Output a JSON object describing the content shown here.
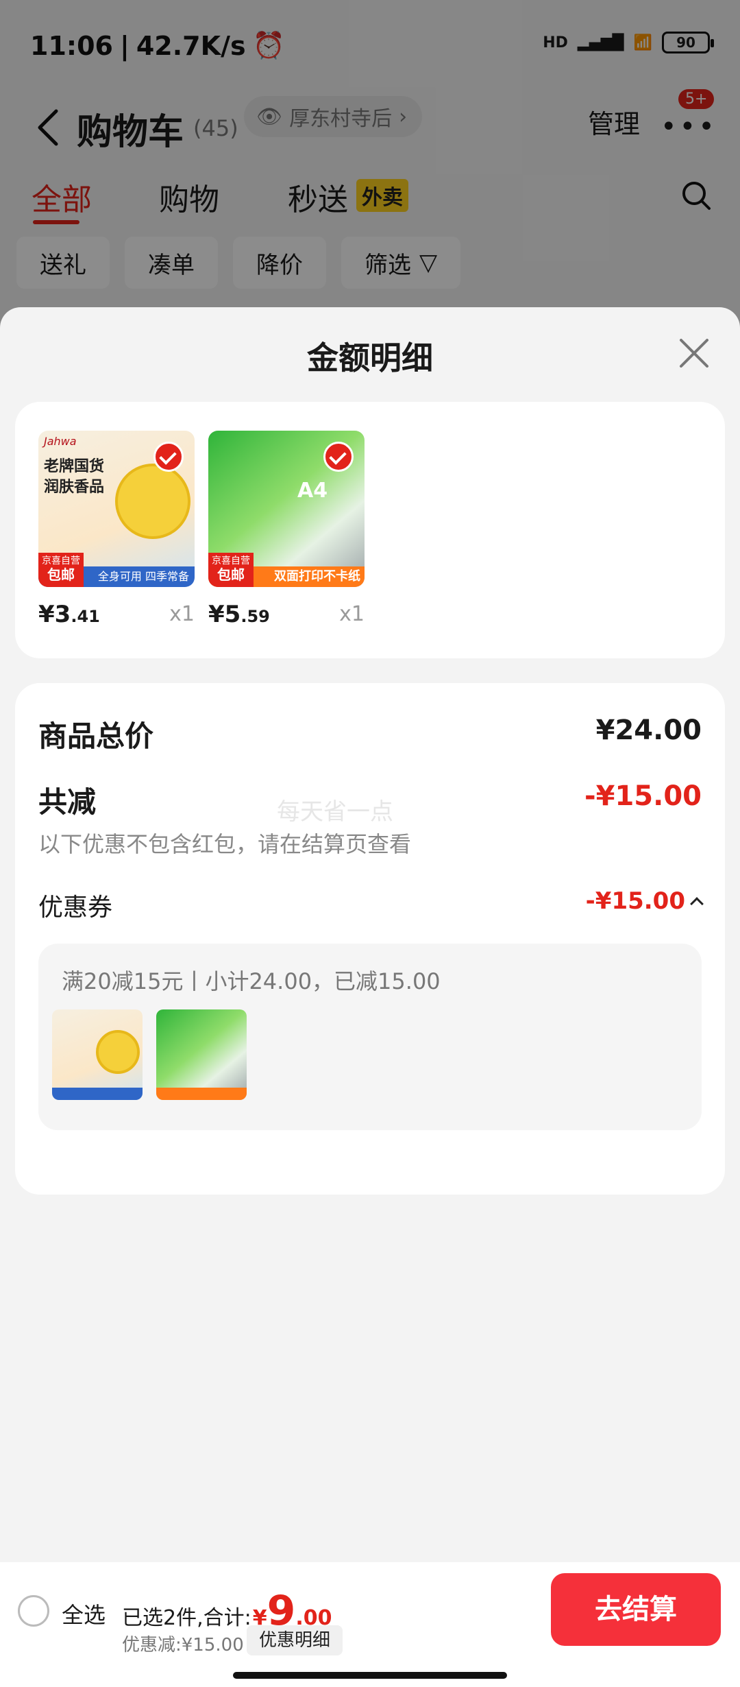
{
  "status_bar": {
    "time": "11:06",
    "separator": "|",
    "speed": "42.7K/s",
    "network": "HD",
    "battery": "90"
  },
  "header": {
    "title": "购物车",
    "count": "(45)",
    "location": "厚东村寺后",
    "manage": "管理",
    "more_badge": "5+"
  },
  "tabs": [
    {
      "label": "全部",
      "active": true
    },
    {
      "label": "购物"
    },
    {
      "label": "秒送",
      "badge": "外卖"
    }
  ],
  "filters": [
    "送礼",
    "凑单",
    "降价",
    "筛选"
  ],
  "sheet": {
    "title": "金额明细",
    "products": [
      {
        "price_int": "¥3",
        "price_dec": ".41",
        "qty": "x1"
      },
      {
        "price_int": "¥5",
        "price_dec": ".59",
        "qty": "x1"
      }
    ],
    "product_art": {
      "a": {
        "brand": "Jahwa",
        "line1": "老牌国货",
        "line2": "润肤香品",
        "strip": "全身可用 四季常备",
        "tag_top": "京喜自营",
        "tag_bottom": "包邮"
      },
      "b": {
        "label": "A4",
        "strip": "双面打印不卡纸",
        "tag_top": "京喜自营",
        "tag_bottom": "包邮"
      }
    },
    "total_label": "商品总价",
    "total_value": "¥24.00",
    "reduce_label": "共减",
    "reduce_value": "-¥15.00",
    "note": "以下优惠不包含红包，请在结算页查看",
    "watermark": "每天省一点",
    "coupon_label": "优惠券",
    "coupon_value": "-¥15.00",
    "coupon_desc": "满20减15元丨小计24.00，已减15.00"
  },
  "bottom_bar": {
    "select_all": "全选",
    "selected_text": "已选2件,合计:",
    "yen": "¥",
    "total_int": "9",
    "total_dec": ".00",
    "discount_text": "优惠减:¥15.00",
    "detail_chip": "优惠明细",
    "checkout": "去结算"
  },
  "colors": {
    "accent_red": "#e2231a",
    "checkout_red": "#f5303a",
    "badge_yellow": "#ffd21f"
  }
}
